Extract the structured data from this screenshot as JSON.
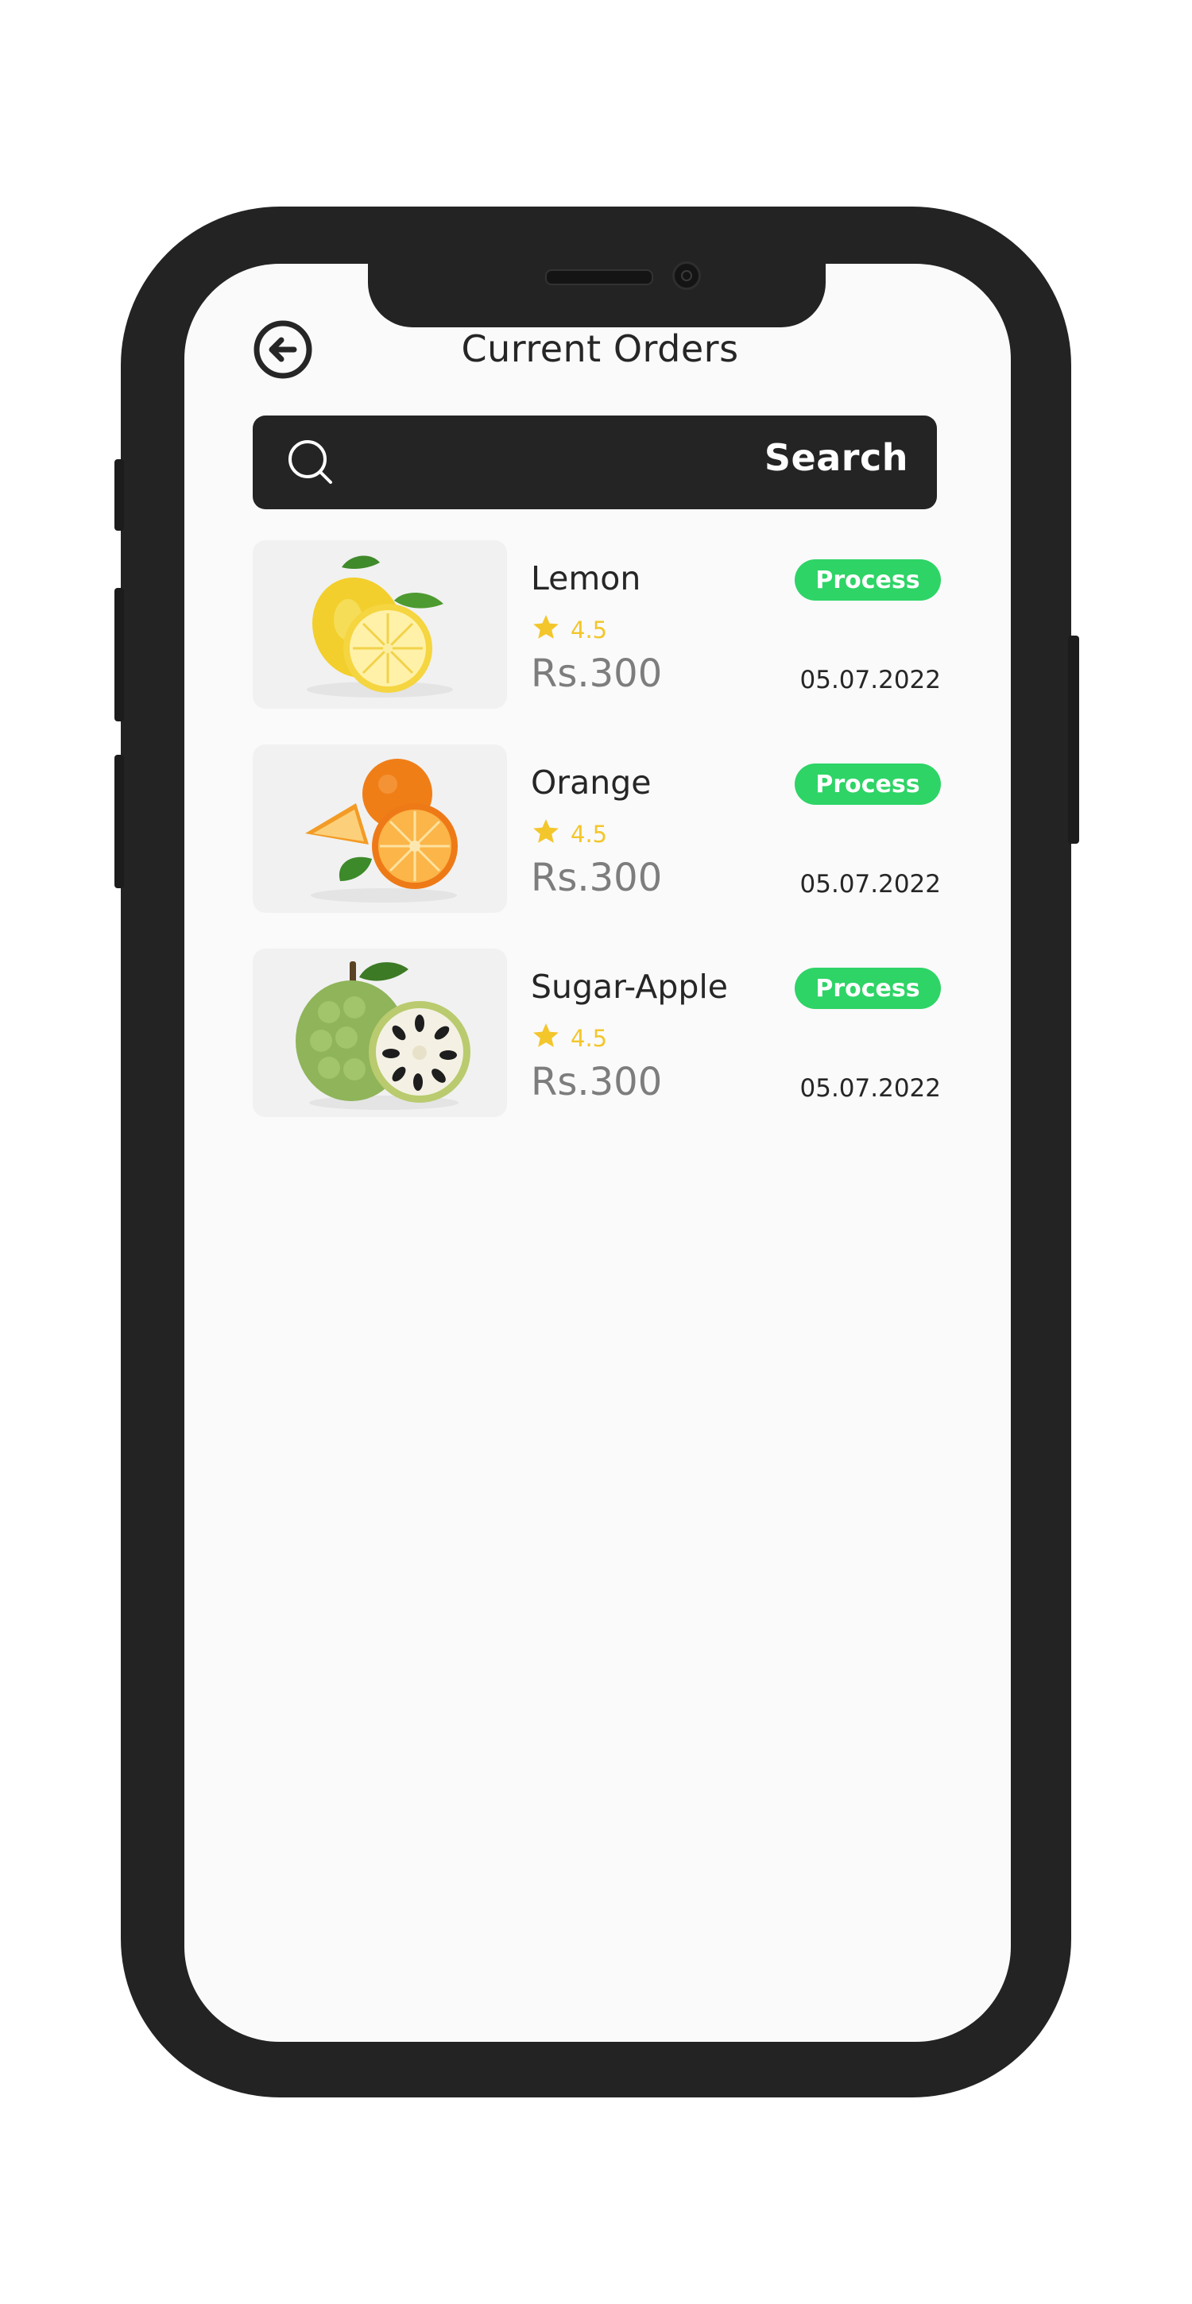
{
  "header": {
    "title": "Current Orders"
  },
  "search": {
    "label": "Search"
  },
  "orders": [
    {
      "name": "Lemon",
      "status": "Process",
      "rating": "4.5",
      "price": "Rs.300",
      "date": "05.07.2022"
    },
    {
      "name": "Orange",
      "status": "Process",
      "rating": "4.5",
      "price": "Rs.300",
      "date": "05.07.2022"
    },
    {
      "name": "Sugar-Apple",
      "status": "Process",
      "rating": "4.5",
      "price": "Rs.300",
      "date": "05.07.2022"
    }
  ],
  "icons": {
    "back": "arrow-left-circle-icon",
    "search": "search-icon",
    "rating": "star-icon"
  },
  "colors": {
    "accent_green": "#2ed466",
    "star_yellow": "#f3c62b",
    "dark": "#242424",
    "muted": "#7d7d7d"
  }
}
